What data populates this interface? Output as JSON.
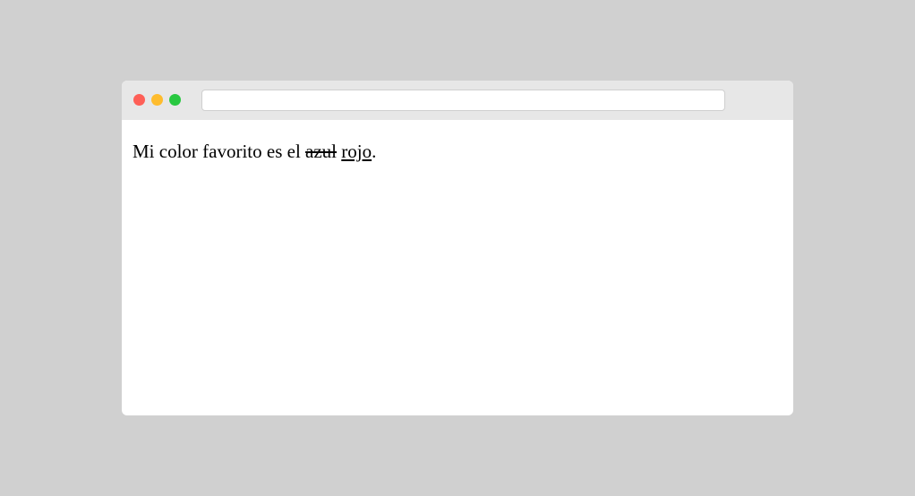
{
  "browser": {
    "address_value": ""
  },
  "content": {
    "text_before": "Mi color favorito es el ",
    "deleted_word": "azul",
    "space": " ",
    "inserted_word": "rojo",
    "text_after": "."
  }
}
